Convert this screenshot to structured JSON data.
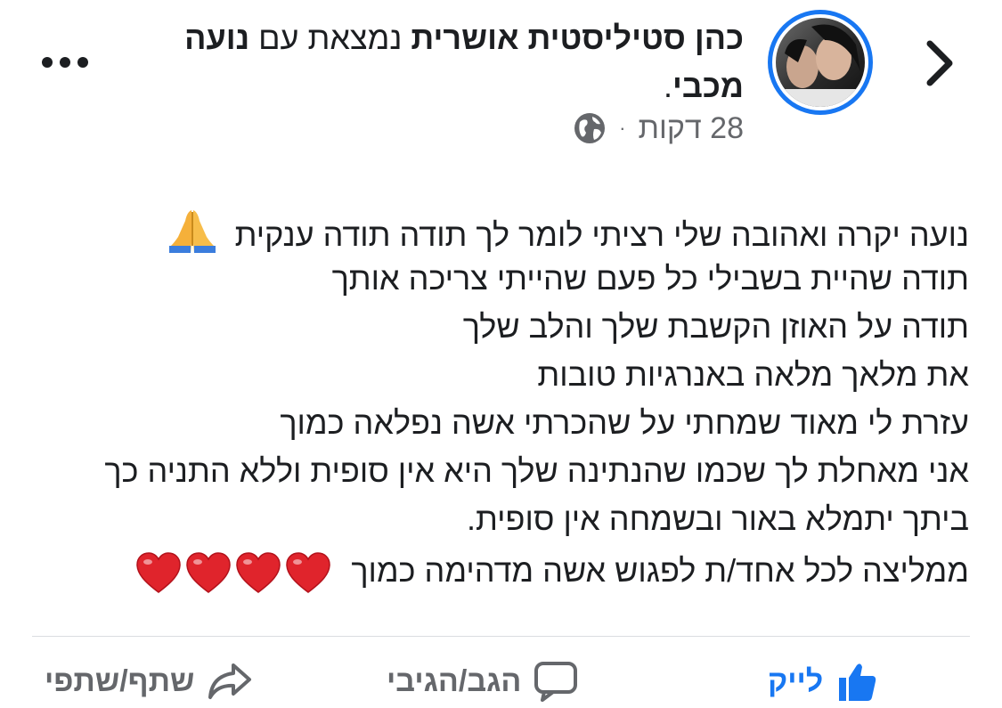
{
  "header": {
    "back_icon": "chevron-right-icon",
    "author_name": "כהן סטיליסטית אושרית",
    "author_connector": "נמצאת עם",
    "tagged_name": "נועה מכבי",
    "time": "28 דקות",
    "separator": "·",
    "privacy_icon": "globe-icon",
    "more_icon": "more-horizontal-icon"
  },
  "post": {
    "lines": [
      "נועה יקרה ואהובה שלי רציתי לומר לך תודה תודה ענקית",
      "תודה שהיית בשבילי כל פעם שהייתי צריכה אותך",
      "תודה על האוזן הקשבת שלך והלב שלך",
      "את מלאך מלאה באנרגיות טובות",
      "עזרת לי מאוד שמחתי על שהכרתי אשה נפלאה כמוך",
      "אני מאחלת לך שכמו שהנתינה שלך היא אין סופית וללא התניה כך",
      "ביתך יתמלא באור ובשמחה אין סופית."
    ],
    "last_line": "ממליצה לכל אחד/ת לפגוש אשה מדהימה כמוך",
    "emoji_hands": "folded-hands-emoji",
    "heart_count": 4
  },
  "actions": {
    "like": "לייק",
    "comment": "הגב/הגיבי",
    "share": "שתף/שתפי"
  },
  "colors": {
    "accent": "#1877f2",
    "text": "#1c1e21",
    "muted": "#65676b",
    "heart": "#e0242c"
  }
}
